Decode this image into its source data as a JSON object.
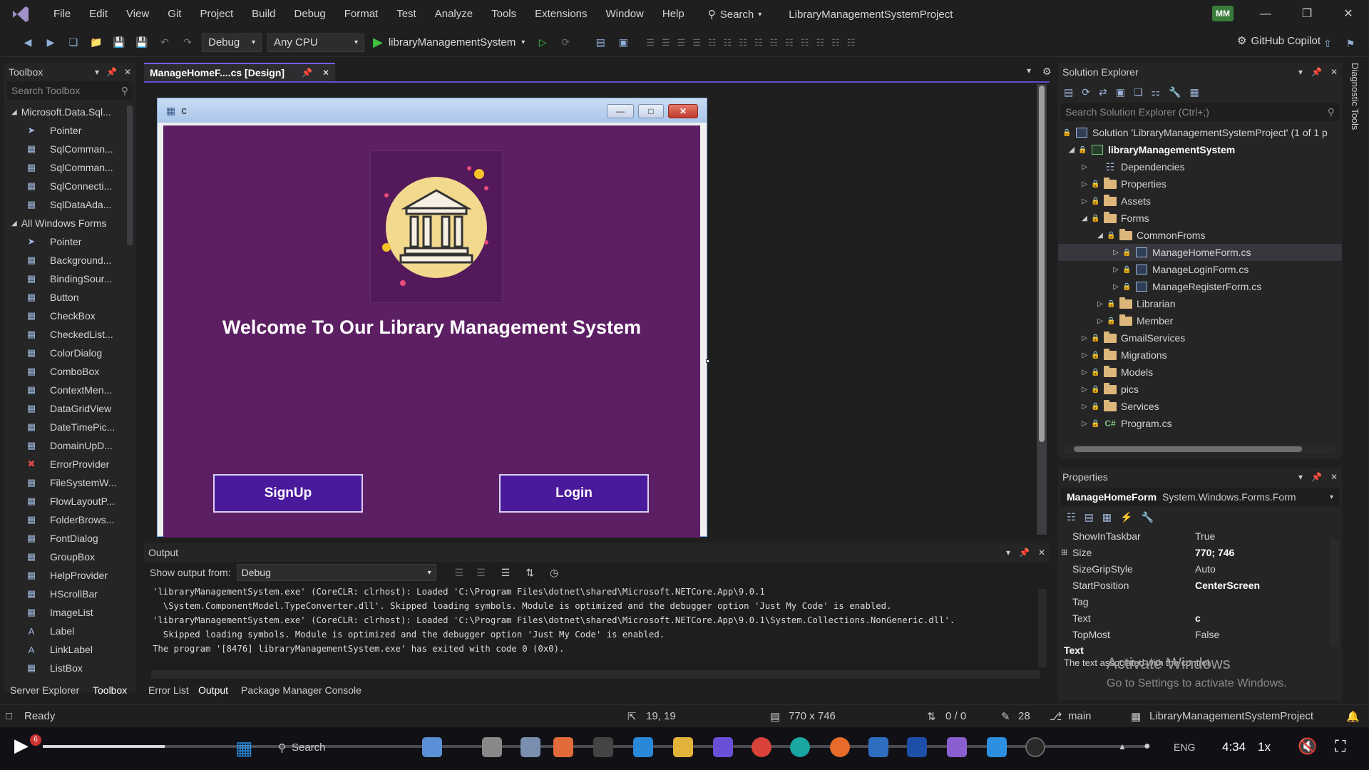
{
  "menu": [
    "File",
    "Edit",
    "View",
    "Git",
    "Project",
    "Build",
    "Debug",
    "Format",
    "Test",
    "Analyze",
    "Tools",
    "Extensions",
    "Window",
    "Help"
  ],
  "search_label": "Search",
  "window_title": "LibraryManagementSystemProject",
  "avatar_initials": "MM",
  "toolbar": {
    "config": "Debug",
    "platform": "Any CPU",
    "run_target": "libraryManagementSystem",
    "copilot": "GitHub Copilot"
  },
  "toolbox": {
    "title": "Toolbox",
    "search_placeholder": "Search Toolbox",
    "group1": "Microsoft.Data.Sql...",
    "group1_items": [
      "Pointer",
      "SqlComman...",
      "SqlComman...",
      "SqlConnecti...",
      "SqlDataAda..."
    ],
    "group2": "All Windows Forms",
    "group2_items": [
      "Pointer",
      "Background...",
      "BindingSour...",
      "Button",
      "CheckBox",
      "CheckedList...",
      "ColorDialog",
      "ComboBox",
      "ContextMen...",
      "DataGridView",
      "DateTimePic...",
      "DomainUpD...",
      "ErrorProvider",
      "FileSystemW...",
      "FlowLayoutP...",
      "FolderBrows...",
      "FontDialog",
      "GroupBox",
      "HelpProvider",
      "HScrollBar",
      "ImageList",
      "Label",
      "LinkLabel",
      "ListBox"
    ],
    "bottom_tabs": [
      "Server Explorer",
      "Toolbox"
    ]
  },
  "doc_tab": "ManageHomeF....cs [Design]",
  "form": {
    "title": "c",
    "welcome": "Welcome To Our Library Management System",
    "signup": "SignUp",
    "login": "Login"
  },
  "output": {
    "title": "Output",
    "show_from_label": "Show output from:",
    "source": "Debug",
    "lines": [
      "'libraryManagementSystem.exe' (CoreCLR: clrhost): Loaded 'C:\\Program Files\\dotnet\\shared\\Microsoft.NETCore.App\\9.0.1",
      "  \\System.ComponentModel.TypeConverter.dll'. Skipped loading symbols. Module is optimized and the debugger option 'Just My Code' is enabled.",
      "'libraryManagementSystem.exe' (CoreCLR: clrhost): Loaded 'C:\\Program Files\\dotnet\\shared\\Microsoft.NETCore.App\\9.0.1\\System.Collections.NonGeneric.dll'.",
      "  Skipped loading symbols. Module is optimized and the debugger option 'Just My Code' is enabled.",
      "The program '[8476] libraryManagementSystem.exe' has exited with code 0 (0x0)."
    ],
    "tabs": [
      "Error List",
      "Output",
      "Package Manager Console"
    ]
  },
  "solution_explorer": {
    "title": "Solution Explorer",
    "search_placeholder": "Search Solution Explorer (Ctrl+;)",
    "solution": "Solution 'LibraryManagementSystemProject' (1 of 1 p",
    "project": "libraryManagementSystem",
    "items": {
      "dependencies": "Dependencies",
      "properties": "Properties",
      "assets": "Assets",
      "forms": "Forms",
      "commonfroms": "CommonFroms",
      "home": "ManageHomeForm.cs",
      "login": "ManageLoginForm.cs",
      "register": "ManageRegisterForm.cs",
      "librarian": "Librarian",
      "member": "Member",
      "gmail": "GmailServices",
      "migrations": "Migrations",
      "models": "Models",
      "pics": "pics",
      "services": "Services",
      "program": "Program.cs"
    }
  },
  "properties": {
    "title": "Properties",
    "object": "ManageHomeForm",
    "type": "System.Windows.Forms.Form",
    "rows": [
      {
        "name": "ShowInTaskbar",
        "value": "True"
      },
      {
        "name": "Size",
        "value": "770; 746"
      },
      {
        "name": "SizeGripStyle",
        "value": "Auto"
      },
      {
        "name": "StartPosition",
        "value": "CenterScreen"
      },
      {
        "name": "Tag",
        "value": ""
      },
      {
        "name": "Text",
        "value": "c"
      },
      {
        "name": "TopMost",
        "value": "False"
      }
    ],
    "desc_title": "Text",
    "desc": "The text associated with the control."
  },
  "diagnostic_tab": "Diagnostic Tools",
  "status": {
    "ready": "Ready",
    "position": "19, 19",
    "size": "770 x 746",
    "changes": "0 / 0",
    "edits": "28",
    "branch": "main",
    "repo": "LibraryManagementSystemProject"
  },
  "watermark": {
    "line1": "Activate Windows",
    "line2": "Go to Settings to activate Windows."
  },
  "video": {
    "time": "4:34",
    "speed": "1x",
    "lang": "ENG",
    "taskbar_search": "Search",
    "progress": 0.11
  }
}
